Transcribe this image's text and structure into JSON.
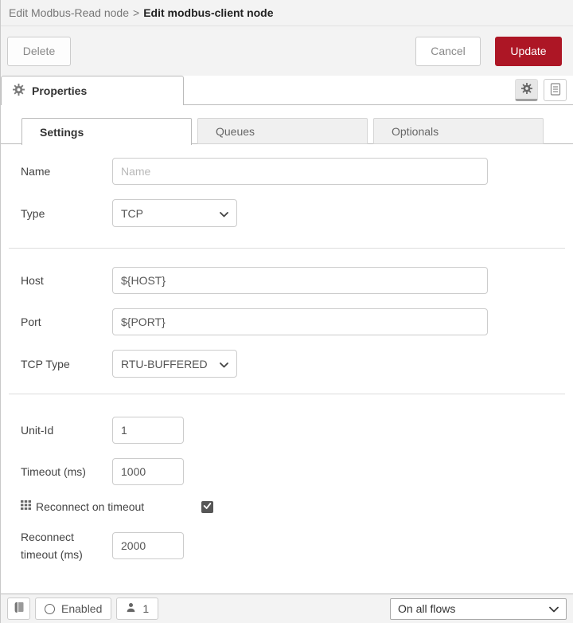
{
  "colors": {
    "accent_red": "#AD1625",
    "header_bg": "#f3f3f3"
  },
  "breadcrumb": {
    "parent": "Edit Modbus-Read node",
    "separator": ">",
    "current": "Edit modbus-client node"
  },
  "toolbar": {
    "delete_label": "Delete",
    "cancel_label": "Cancel",
    "update_label": "Update"
  },
  "properties": {
    "tab_label": "Properties"
  },
  "tabs": [
    {
      "label": "Settings",
      "active": true
    },
    {
      "label": "Queues",
      "active": false
    },
    {
      "label": "Optionals",
      "active": false
    }
  ],
  "form": {
    "name": {
      "label": "Name",
      "placeholder": "Name",
      "value": ""
    },
    "type": {
      "label": "Type",
      "value": "TCP"
    },
    "host": {
      "label": "Host",
      "value": "${HOST}"
    },
    "port": {
      "label": "Port",
      "value": "${PORT}"
    },
    "tcp_type": {
      "label": "TCP Type",
      "value": "RTU-BUFFERED"
    },
    "unit_id": {
      "label": "Unit-Id",
      "value": "1"
    },
    "timeout": {
      "label": "Timeout (ms)",
      "value": "1000"
    },
    "reconnect_on_timeout": {
      "label": "Reconnect on timeout",
      "checked": true
    },
    "reconnect_timeout": {
      "label_line1": "Reconnect",
      "label_line2": "timeout (ms)",
      "value": "2000"
    }
  },
  "footer": {
    "enabled_label": "Enabled",
    "node_count": "1",
    "deploy_scope": "On all flows"
  }
}
